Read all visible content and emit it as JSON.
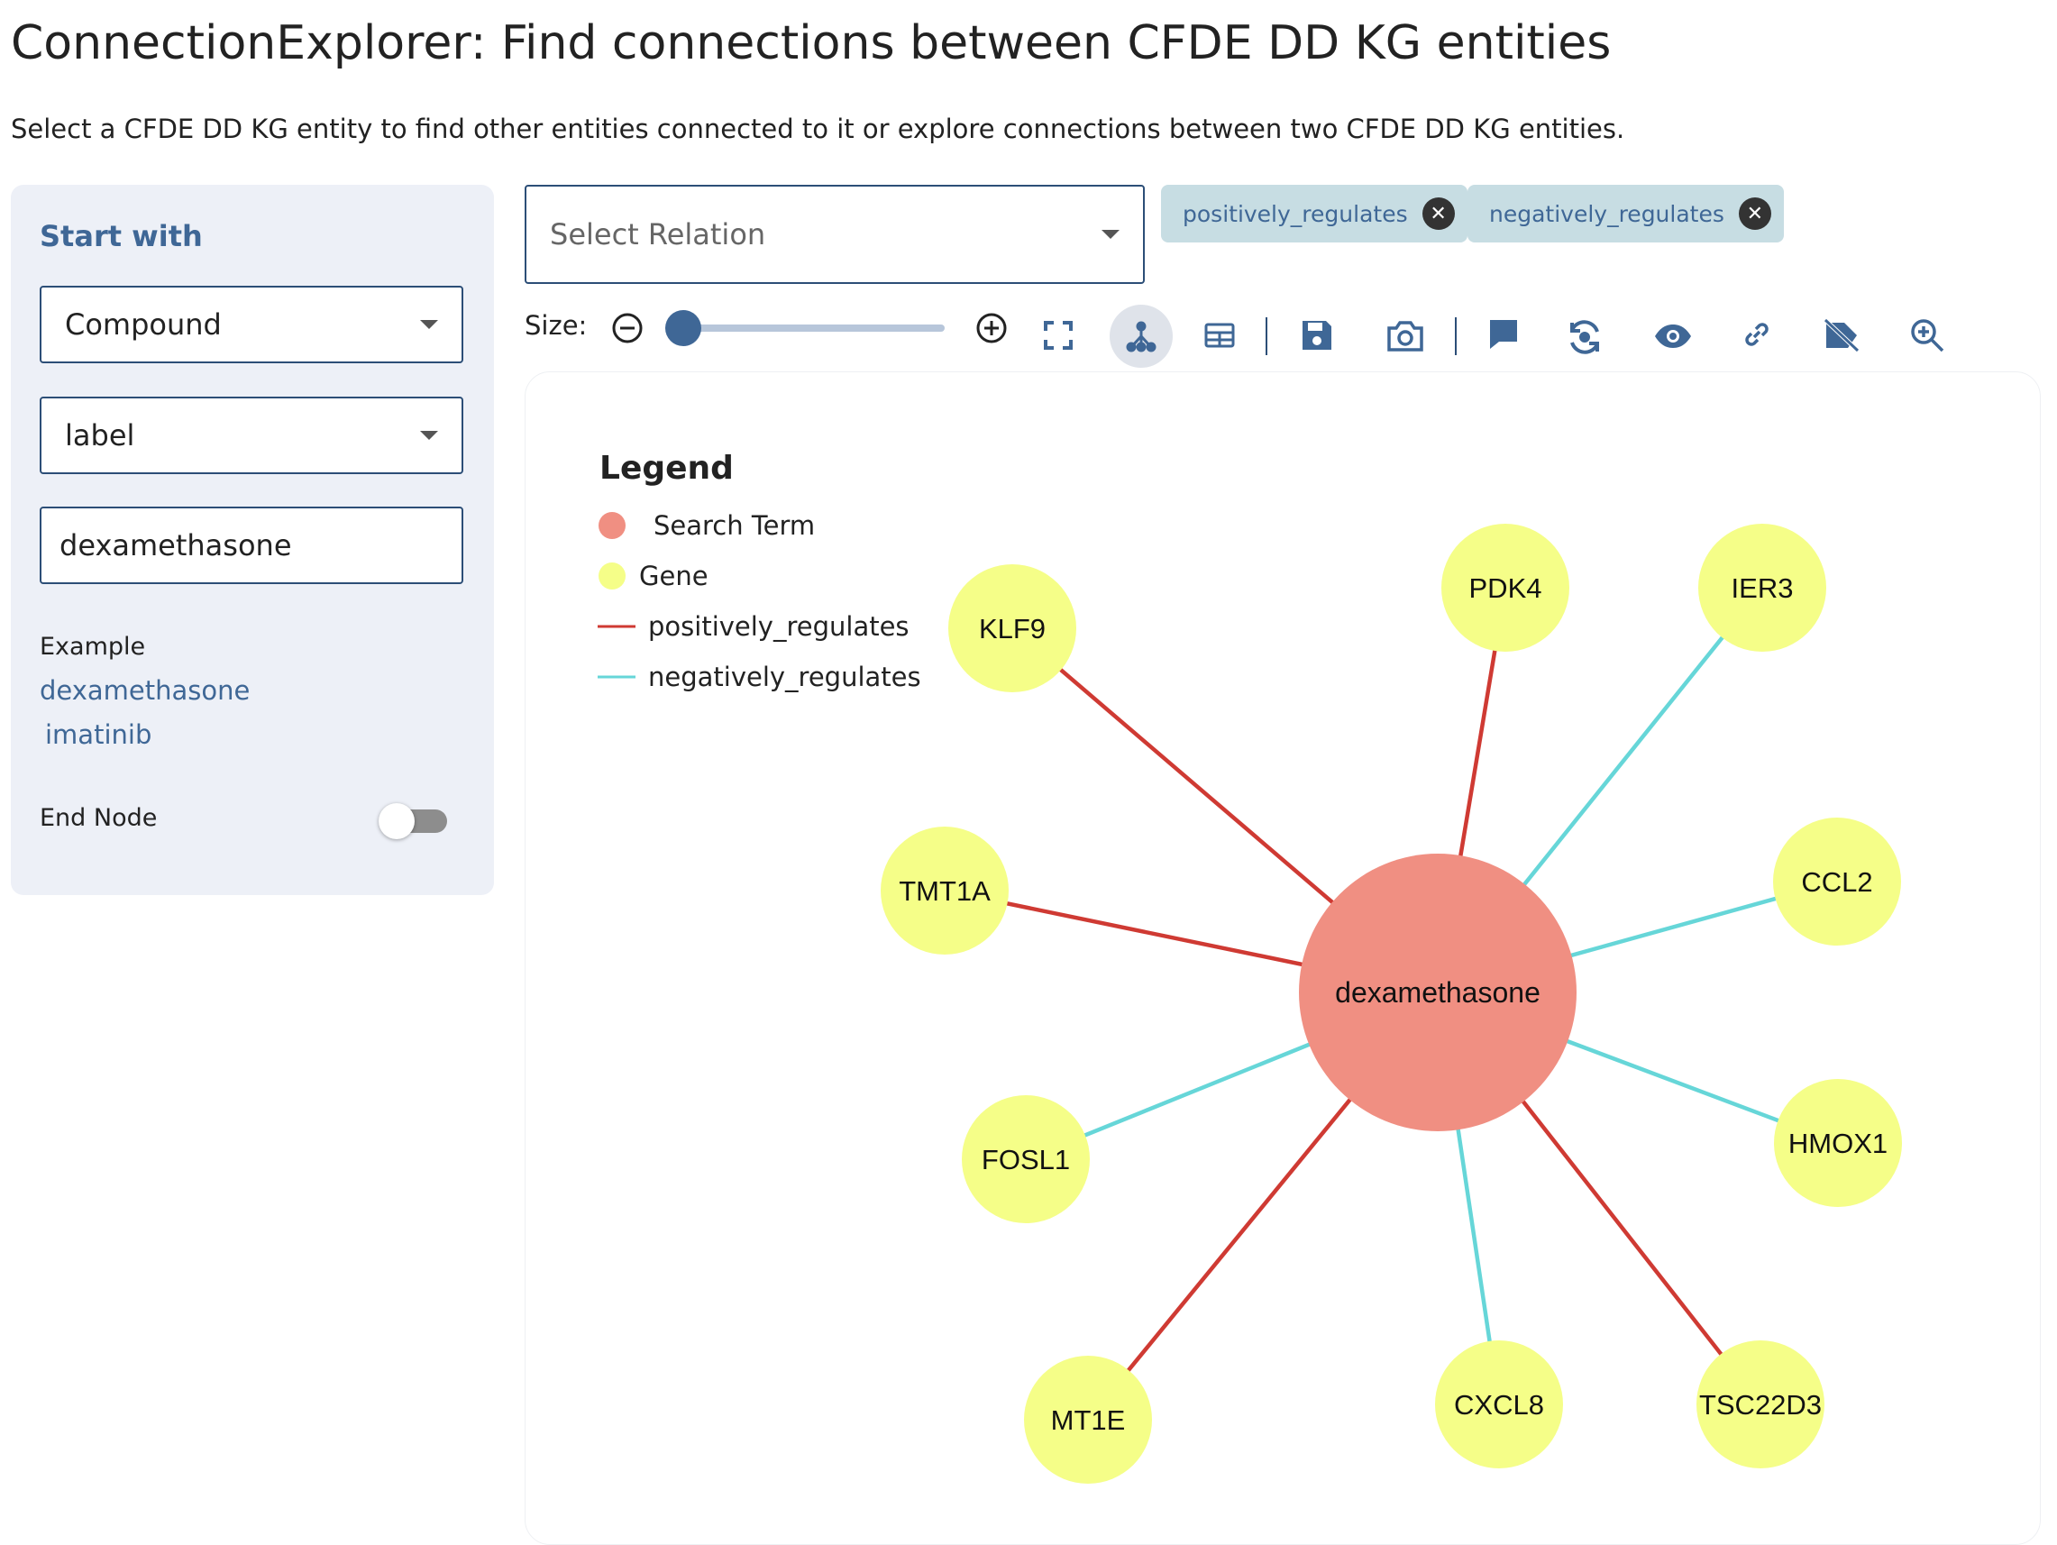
{
  "page": {
    "title": "ConnectionExplorer: Find connections between CFDE DD KG entities",
    "subtitle": "Select a CFDE DD KG entity to find other entities connected to it or explore connections between two CFDE DD KG entities."
  },
  "sidebar": {
    "heading": "Start with",
    "entity_type": "Compound",
    "field": "label",
    "search_value": "dexamethasone",
    "example_label": "Example",
    "examples": [
      "dexamethasone",
      "imatinib"
    ],
    "end_node_label": "End Node",
    "end_node_enabled": false
  },
  "relations": {
    "placeholder": "Select Relation",
    "selected": [
      "positively_regulates",
      "negatively_regulates"
    ]
  },
  "toolbar": {
    "size_label": "Size:",
    "size_value": 0,
    "icons": [
      "zoom-out-icon",
      "zoom-in-icon",
      "fullscreen-icon",
      "graph-layout-icon",
      "table-icon",
      "save-icon",
      "camera-icon",
      "comment-icon",
      "refresh-icon",
      "eye-icon",
      "link-icon",
      "hide-label-icon",
      "search-zoom-icon"
    ]
  },
  "legend": {
    "title": "Legend",
    "items": [
      {
        "kind": "node",
        "label": "Search Term",
        "color": "#f08f82"
      },
      {
        "kind": "node",
        "label": "Gene",
        "color": "#f5fe88"
      },
      {
        "kind": "edge",
        "label": "positively_regulates",
        "color": "#cf3a33"
      },
      {
        "kind": "edge",
        "label": "negatively_regulates",
        "color": "#66d6d8"
      }
    ]
  },
  "graph": {
    "center": {
      "label": "dexamethasone",
      "type": "Search Term"
    },
    "nodes": [
      {
        "label": "KLF9",
        "relation": "positively_regulates"
      },
      {
        "label": "PDK4",
        "relation": "positively_regulates"
      },
      {
        "label": "IER3",
        "relation": "negatively_regulates"
      },
      {
        "label": "TMT1A",
        "relation": "positively_regulates"
      },
      {
        "label": "CCL2",
        "relation": "negatively_regulates"
      },
      {
        "label": "FOSL1",
        "relation": "negatively_regulates"
      },
      {
        "label": "HMOX1",
        "relation": "negatively_regulates"
      },
      {
        "label": "MT1E",
        "relation": "positively_regulates"
      },
      {
        "label": "CXCL8",
        "relation": "negatively_regulates"
      },
      {
        "label": "TSC22D3",
        "relation": "positively_regulates"
      }
    ]
  },
  "colors": {
    "accent": "#3f6796",
    "border": "#2c4e77",
    "sidebar_bg": "#edf0f7",
    "chip_bg": "#c7dde3",
    "search_term": "#f08f82",
    "gene": "#f5fe88",
    "positive_edge": "#cf3a33",
    "negative_edge": "#66d6d8"
  }
}
